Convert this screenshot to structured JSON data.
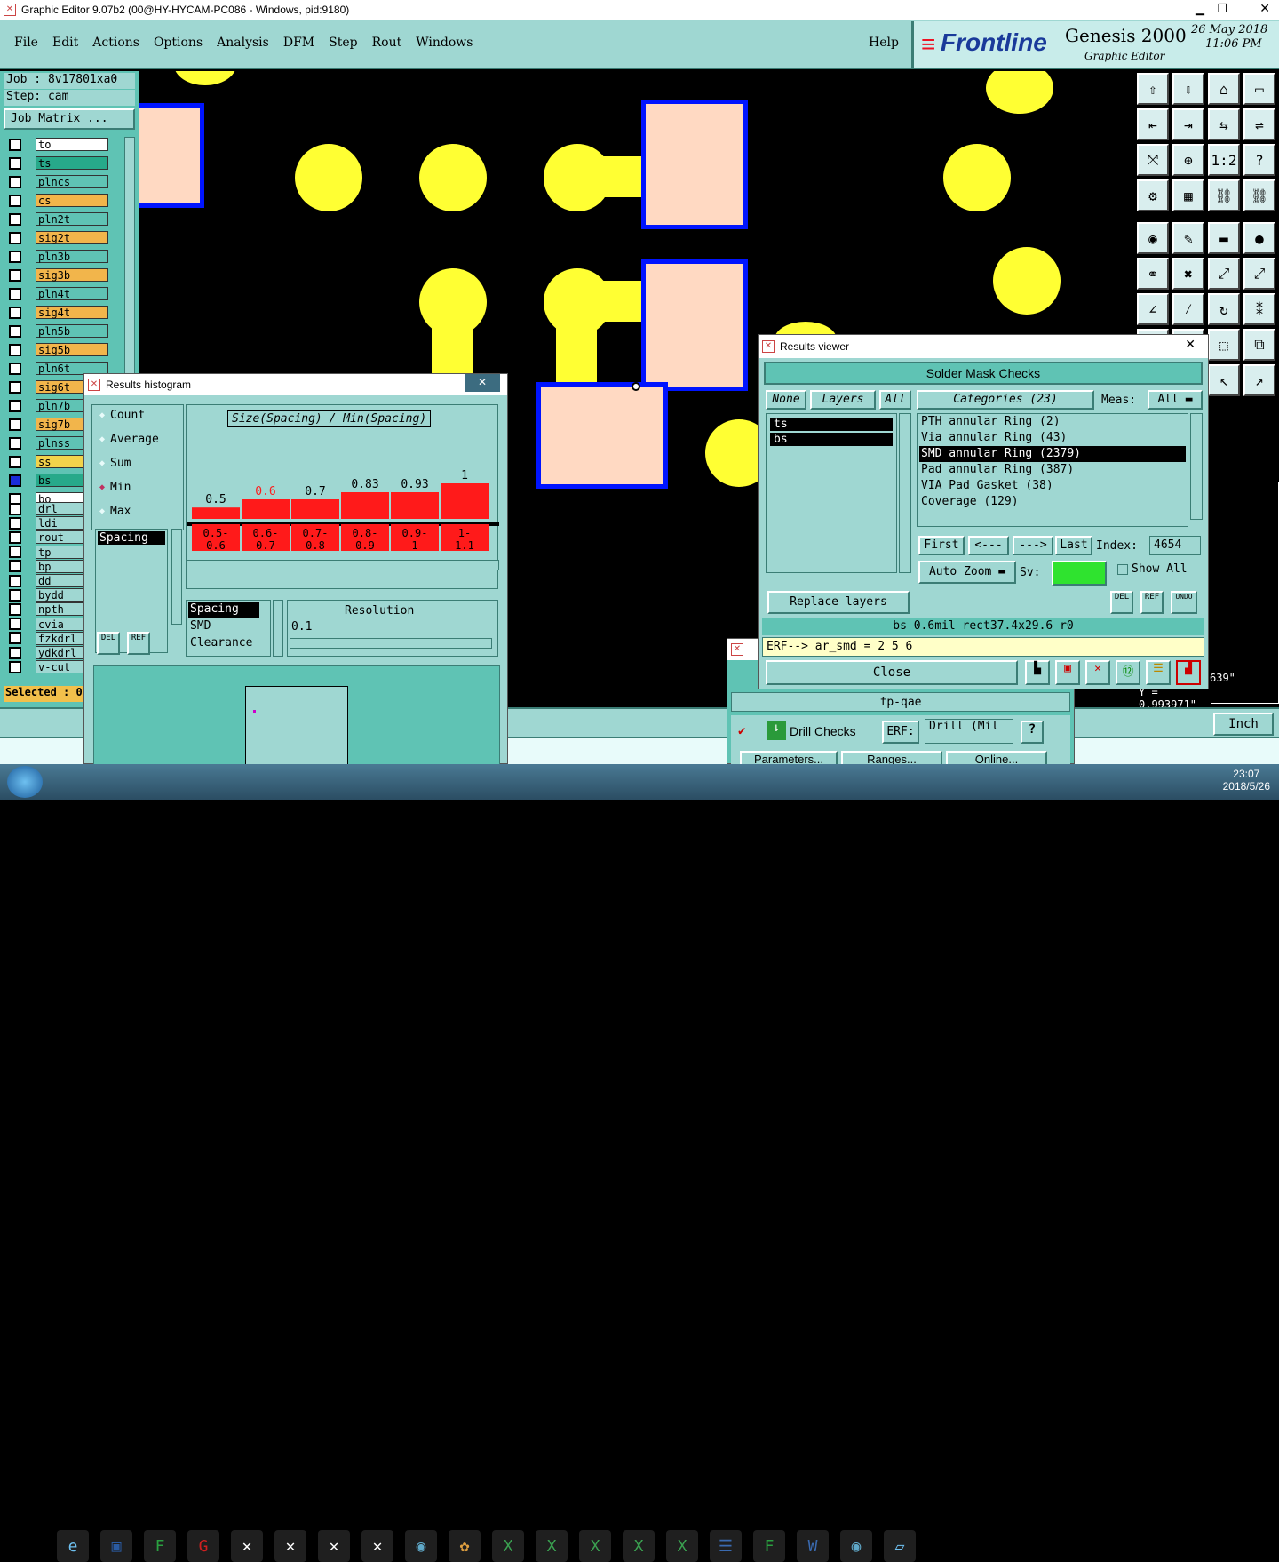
{
  "title_bar": {
    "title": "Graphic Editor 9.07b2 (00@HY-HYCAM-PC086 - Windows, pid:9180)"
  },
  "menu": [
    "File",
    "Edit",
    "Actions",
    "Options",
    "Analysis",
    "DFM",
    "Step",
    "Rout",
    "Windows"
  ],
  "help_label": "Help",
  "brand": {
    "logo": "Frontline",
    "product": "Genesis 2000",
    "subtitle": "Graphic Editor",
    "date": "26 May 2018",
    "time": "11:06 PM"
  },
  "job": {
    "job_label": "Job : 8v17801xa0",
    "step_label": "Step: cam",
    "matrix_button": "Job Matrix ..."
  },
  "layers": [
    {
      "name": "to",
      "color": "#ffffff"
    },
    {
      "name": "ts",
      "color": "#27a98a"
    },
    {
      "name": "plncs",
      "color": "#5fc3b4"
    },
    {
      "name": "cs",
      "color": "#f2b54b"
    },
    {
      "name": "pln2t",
      "color": "#5fc3b4"
    },
    {
      "name": "sig2t",
      "color": "#f2b54b"
    },
    {
      "name": "pln3b",
      "color": "#5fc3b4"
    },
    {
      "name": "sig3b",
      "color": "#f2b54b"
    },
    {
      "name": "pln4t",
      "color": "#5fc3b4"
    },
    {
      "name": "sig4t",
      "color": "#f2b54b"
    },
    {
      "name": "pln5b",
      "color": "#5fc3b4"
    },
    {
      "name": "sig5b",
      "color": "#f2b54b"
    },
    {
      "name": "pln6t",
      "color": "#5fc3b4"
    },
    {
      "name": "sig6t",
      "color": "#f2b54b"
    },
    {
      "name": "pln7b",
      "color": "#5fc3b4"
    },
    {
      "name": "sig7b",
      "color": "#f2b54b"
    },
    {
      "name": "plnss",
      "color": "#5fc3b4"
    },
    {
      "name": "ss",
      "color": "#f2d34b"
    },
    {
      "name": "bs",
      "color": "#27a98a"
    },
    {
      "name": "bo",
      "color": "#ffffff"
    },
    {
      "name": "drl",
      "color": "#9fd7d2"
    },
    {
      "name": "ldi",
      "color": "#9fd7d2"
    },
    {
      "name": "rout",
      "color": "#9fd7d2"
    },
    {
      "name": "tp",
      "color": "#9fd7d2"
    },
    {
      "name": "bp",
      "color": "#9fd7d2"
    },
    {
      "name": "dd",
      "color": "#9fd7d2"
    },
    {
      "name": "bydd",
      "color": "#9fd7d2"
    },
    {
      "name": "npth",
      "color": "#9fd7d2"
    },
    {
      "name": "cvia",
      "color": "#9fd7d2"
    },
    {
      "name": "fzkdrl",
      "color": "#9fd7d2"
    },
    {
      "name": "ydkdrl",
      "color": "#9fd7d2"
    },
    {
      "name": "v-cut",
      "color": "#9fd7d2"
    }
  ],
  "selected_label": "Selected : 0",
  "histogram": {
    "title": "Results histogram",
    "modes": [
      "Count",
      "Average",
      "Sum",
      "Min",
      "Max"
    ],
    "selected_mode": "Min",
    "chart_title": "Size(Spacing) / Min(Spacing)",
    "measure_list": [
      "Spacing"
    ],
    "bars": [
      {
        "value": "0.5",
        "height": 0.32,
        "range": "0.5-\n0.6",
        "highlight": false
      },
      {
        "value": "0.6",
        "height": 0.55,
        "range": "0.6-\n0.7",
        "highlight": true
      },
      {
        "value": "0.7",
        "height": 0.55,
        "range": "0.7-\n0.8",
        "highlight": false
      },
      {
        "value": "0.83",
        "height": 0.75,
        "range": "0.8-\n0.9",
        "highlight": false
      },
      {
        "value": "0.93",
        "height": 0.75,
        "range": "0.9-\n1",
        "highlight": false
      },
      {
        "value": "1",
        "height": 1.0,
        "range": "1-\n1.1",
        "highlight": false
      }
    ],
    "measure_types": [
      "Spacing",
      "SMD",
      "Clearance"
    ],
    "resolution_label": "Resolution",
    "resolution_value": "0.1",
    "del_label": "DEL",
    "ref_label": "REF"
  },
  "results_viewer": {
    "title": "Results viewer",
    "header": "Solder Mask Checks",
    "none_btn": "None",
    "layers_btn": "Layers",
    "all_btn": "All",
    "layers": [
      "ts",
      "bs"
    ],
    "categories_label": "Categories (23)",
    "meas_label": "Meas:",
    "meas_value": "All",
    "categories": [
      "PTH annular Ring (2)",
      "Via annular Ring (43)",
      "SMD annular Ring (2379)",
      "Pad annular Ring (387)",
      "VIA Pad Gasket (38)",
      "Coverage (129)"
    ],
    "selected_category": "SMD annular Ring (2379)",
    "first_btn": "First",
    "prev_btn": "<---",
    "next_btn": "--->",
    "last_btn": "Last",
    "index_label": "Index:",
    "index_value": "4654",
    "autozoom_label": "Auto Zoom",
    "sv_label": "Sv:",
    "show_all_label": "Show All",
    "replace_layers": "Replace layers",
    "del_label": "DEL",
    "ref_label": "REF",
    "undo_label": "UNDO",
    "status": "bs 0.6mil  rect37.4x29.6  r0",
    "erf_line": "ERF--> ar_smd = 2 5 6",
    "close_label": "Close"
  },
  "fp_qae": {
    "title": "fp-qae",
    "drill_checks": "Drill Checks",
    "erf_label": "ERF:",
    "erf_value": "Drill (Mil",
    "help": "?",
    "parameters": "Parameters...",
    "ranges": "Ranges...",
    "online": "Online..."
  },
  "coords": {
    "x": "639\"",
    "y": "Y = 0.993971\""
  },
  "unit_label": "Inch",
  "clock": {
    "time": "23:07",
    "date": "2018/5/26"
  }
}
